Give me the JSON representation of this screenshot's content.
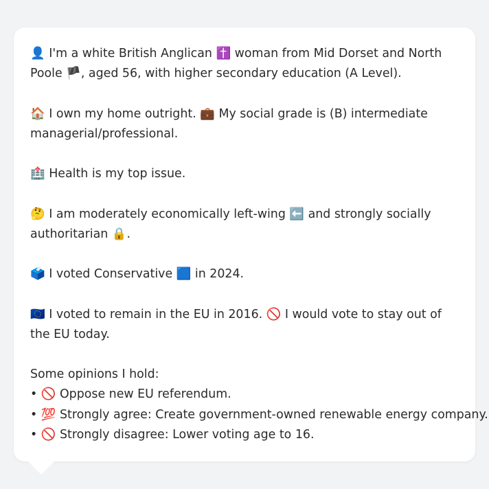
{
  "profile": {
    "intro": {
      "emoji_person": "👤",
      "text1": "I'm a white British Anglican",
      "emoji_cross": "✝️",
      "text2": "woman from Mid Dorset and North Poole",
      "emoji_flag": "🏴",
      "text3": ", aged 56, with higher secondary education (A Level)."
    },
    "home": {
      "emoji_house": "🏠",
      "text1": "I own my home outright.",
      "emoji_briefcase": "💼",
      "text2": "My social grade is (B) intermediate managerial/professional."
    },
    "issue": {
      "emoji_hospital": "🏥",
      "text": "Health is my top issue."
    },
    "ideology": {
      "emoji_thinking": "🤔",
      "text1": "I am moderately economically left-wing",
      "emoji_left": "⬅️",
      "text2": "and strongly socially authoritarian",
      "emoji_lock": "🔒",
      "text3": "."
    },
    "vote": {
      "emoji_ballot": "🗳️",
      "text1": "I voted Conservative",
      "emoji_blue": "🟦",
      "text2": "in 2024."
    },
    "eu": {
      "emoji_eu": "🇪🇺",
      "text1": "I voted to remain in the EU in 2016.",
      "emoji_no": "🚫",
      "text2": "I would vote to stay out of the EU today."
    },
    "opinions": {
      "heading": "Some opinions I hold:",
      "bullet": "•",
      "items": [
        {
          "emoji": "🚫",
          "text": "Oppose new EU referendum."
        },
        {
          "emoji": "💯",
          "text": "Strongly agree: Create government-owned renewable energy company."
        },
        {
          "emoji": "🚫",
          "text": "Strongly disagree: Lower voting age to 16."
        }
      ]
    }
  },
  "colors": {
    "background": "#f2f3f5",
    "bubble": "#ffffff",
    "text": "#2b2b2b"
  }
}
